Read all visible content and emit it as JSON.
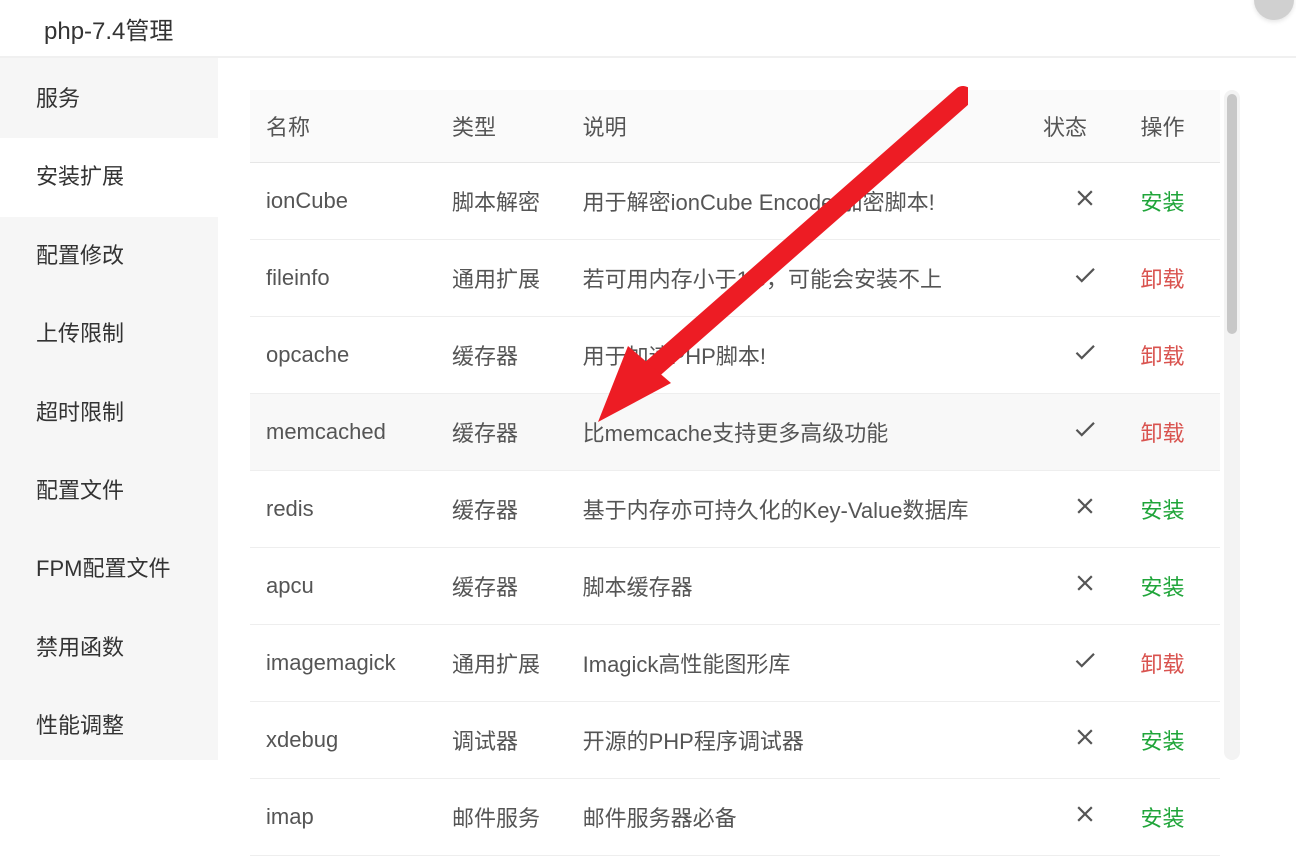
{
  "header": {
    "title": "php-7.4管理"
  },
  "sidebar": {
    "items": [
      {
        "label": "服务"
      },
      {
        "label": "安装扩展"
      },
      {
        "label": "配置修改"
      },
      {
        "label": "上传限制"
      },
      {
        "label": "超时限制"
      },
      {
        "label": "配置文件"
      },
      {
        "label": "FPM配置文件"
      },
      {
        "label": "禁用函数"
      },
      {
        "label": "性能调整"
      }
    ],
    "activeIndex": 1
  },
  "table": {
    "headers": {
      "name": "名称",
      "type": "类型",
      "description": "说明",
      "status": "状态",
      "action": "操作"
    },
    "rows": [
      {
        "name": "ionCube",
        "type": "脚本解密",
        "description": "用于解密ionCube Encoder加密脚本!",
        "installed": false,
        "actionLabel": "安装",
        "highlight": false
      },
      {
        "name": "fileinfo",
        "type": "通用扩展",
        "description": "若可用内存小于1G，可能会安装不上",
        "installed": true,
        "actionLabel": "卸载",
        "highlight": false
      },
      {
        "name": "opcache",
        "type": "缓存器",
        "description": "用于加速PHP脚本!",
        "installed": true,
        "actionLabel": "卸载",
        "highlight": false
      },
      {
        "name": "memcached",
        "type": "缓存器",
        "description": "比memcache支持更多高级功能",
        "installed": true,
        "actionLabel": "卸载",
        "highlight": true
      },
      {
        "name": "redis",
        "type": "缓存器",
        "description": "基于内存亦可持久化的Key-Value数据库",
        "installed": false,
        "actionLabel": "安装",
        "highlight": false
      },
      {
        "name": "apcu",
        "type": "缓存器",
        "description": "脚本缓存器",
        "installed": false,
        "actionLabel": "安装",
        "highlight": false
      },
      {
        "name": "imagemagick",
        "type": "通用扩展",
        "description": "Imagick高性能图形库",
        "installed": true,
        "actionLabel": "卸载",
        "highlight": false
      },
      {
        "name": "xdebug",
        "type": "调试器",
        "description": "开源的PHP程序调试器",
        "installed": false,
        "actionLabel": "安装",
        "highlight": false
      },
      {
        "name": "imap",
        "type": "邮件服务",
        "description": "邮件服务器必备",
        "installed": false,
        "actionLabel": "安装",
        "highlight": false
      }
    ]
  },
  "overrides": {
    "row0_desc_prefix": "用于",
    "row0_desc_suffix": "解密ionCube Encoder加密脚本!",
    "row1_type_prefix": "通用扩",
    "row2_type_suffix": "存器"
  },
  "colors": {
    "install": "#20a53a",
    "uninstall": "#d9534f",
    "arrow": "#ed1c24"
  }
}
